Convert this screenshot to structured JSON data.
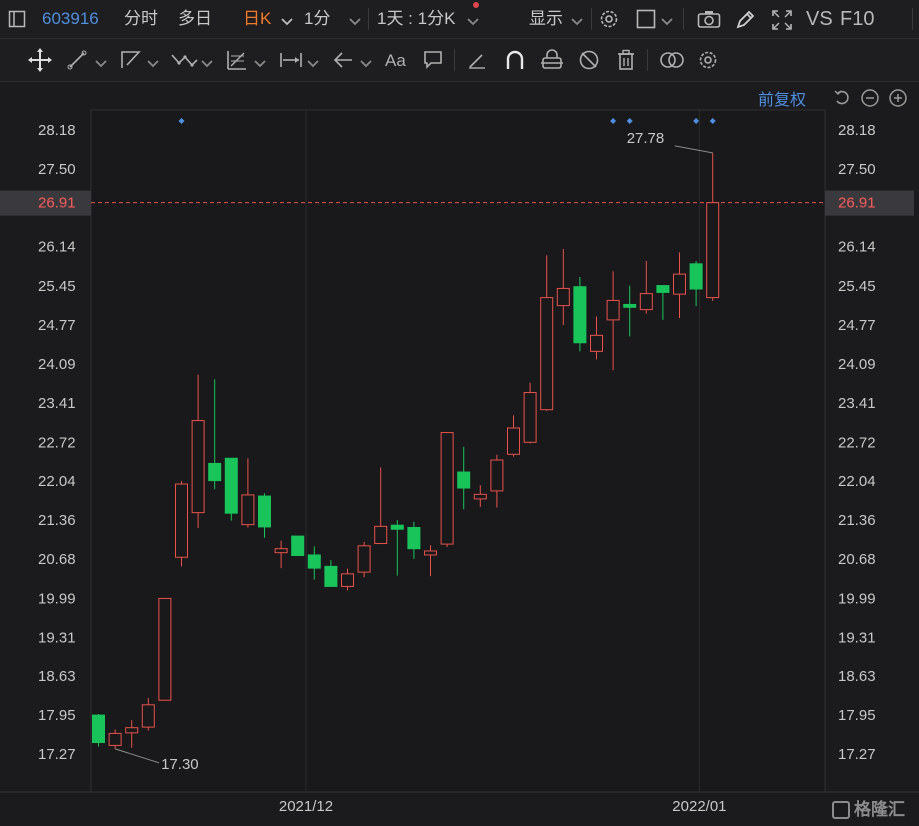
{
  "toolbar": {
    "code": "603916",
    "tab_fenshi": "分时",
    "tab_duori": "多日",
    "tab_rik": "日K",
    "tab_1fen": "1分",
    "tab_1tian": "1天 : 1分K",
    "display": "显示",
    "vs": "VS",
    "f10": "F10"
  },
  "chart_header": {
    "adjust_label": "前复权"
  },
  "watermark": "格隆汇",
  "colors": {
    "up": "#e8524a",
    "down": "#19c45a",
    "accent": "#4f8fe0",
    "active_tab": "#f07a2a"
  },
  "icons": [
    "panel-icon",
    "crosshair-icon",
    "line-tool-icon",
    "polyline-tool-icon",
    "wave-tool-icon",
    "fib-tool-icon",
    "range-tool-icon",
    "arrow-tool-icon",
    "text-tool-icon",
    "note-tool-icon",
    "eraser-icon",
    "magnet-icon",
    "lock-icon",
    "hide-icon",
    "trash-icon",
    "compare-icon",
    "settings-icon",
    "camera-icon",
    "pen-icon",
    "fullscreen-icon",
    "undo-icon",
    "zoom-out-icon",
    "zoom-in-icon"
  ],
  "chart_data": {
    "type": "candlestick",
    "y_ticks": [
      "28.18",
      "27.50",
      "26.91",
      "26.14",
      "25.45",
      "24.77",
      "24.09",
      "23.41",
      "22.72",
      "22.04",
      "21.36",
      "20.68",
      "19.99",
      "19.31",
      "18.63",
      "17.95",
      "17.27"
    ],
    "ylim": [
      17.27,
      28.18
    ],
    "current_price": "26.91",
    "x_labels": [
      {
        "label": "2021/12",
        "index": 12.5
      },
      {
        "label": "2022/01",
        "index": 36.2
      }
    ],
    "annotations": {
      "high": "27.78",
      "low": "17.30"
    },
    "candles": [
      {
        "o": 17.95,
        "h": 17.97,
        "l": 17.4,
        "c": 17.47
      },
      {
        "o": 17.42,
        "h": 17.7,
        "l": 17.36,
        "c": 17.63
      },
      {
        "o": 17.64,
        "h": 17.86,
        "l": 17.38,
        "c": 17.73
      },
      {
        "o": 17.74,
        "h": 18.25,
        "l": 17.68,
        "c": 18.13
      },
      {
        "o": 18.21,
        "h": 19.99,
        "l": 18.21,
        "c": 19.99
      },
      {
        "o": 20.71,
        "h": 22.04,
        "l": 20.55,
        "c": 21.99
      },
      {
        "o": 21.49,
        "h": 23.9,
        "l": 21.22,
        "c": 23.1
      },
      {
        "o": 22.35,
        "h": 23.82,
        "l": 21.9,
        "c": 22.05
      },
      {
        "o": 22.44,
        "h": 22.44,
        "l": 21.35,
        "c": 21.48
      },
      {
        "o": 21.28,
        "h": 22.44,
        "l": 21.23,
        "c": 21.8
      },
      {
        "o": 21.78,
        "h": 21.83,
        "l": 21.05,
        "c": 21.24
      },
      {
        "o": 20.79,
        "h": 21.0,
        "l": 20.52,
        "c": 20.86
      },
      {
        "o": 21.08,
        "h": 21.08,
        "l": 20.8,
        "c": 20.74
      },
      {
        "o": 20.75,
        "h": 20.9,
        "l": 20.32,
        "c": 20.52
      },
      {
        "o": 20.55,
        "h": 20.66,
        "l": 20.2,
        "c": 20.2
      },
      {
        "o": 20.2,
        "h": 20.51,
        "l": 20.13,
        "c": 20.42
      },
      {
        "o": 20.45,
        "h": 20.98,
        "l": 20.36,
        "c": 20.91
      },
      {
        "o": 20.95,
        "h": 22.28,
        "l": 20.99,
        "c": 21.25
      },
      {
        "o": 21.27,
        "h": 21.36,
        "l": 20.39,
        "c": 21.2
      },
      {
        "o": 21.23,
        "h": 21.33,
        "l": 20.68,
        "c": 20.86
      },
      {
        "o": 20.75,
        "h": 20.92,
        "l": 20.38,
        "c": 20.82
      },
      {
        "o": 20.94,
        "h": 22.89,
        "l": 20.89,
        "c": 22.89
      },
      {
        "o": 22.2,
        "h": 22.64,
        "l": 21.55,
        "c": 21.92
      },
      {
        "o": 21.73,
        "h": 21.97,
        "l": 21.59,
        "c": 21.81
      },
      {
        "o": 21.87,
        "h": 22.5,
        "l": 21.58,
        "c": 22.41
      },
      {
        "o": 22.51,
        "h": 23.19,
        "l": 22.47,
        "c": 22.97
      },
      {
        "o": 22.72,
        "h": 23.76,
        "l": 22.7,
        "c": 23.59
      },
      {
        "o": 23.29,
        "h": 25.99,
        "l": 23.27,
        "c": 25.25
      },
      {
        "o": 25.11,
        "h": 26.1,
        "l": 24.77,
        "c": 25.41
      },
      {
        "o": 25.44,
        "h": 25.61,
        "l": 24.31,
        "c": 24.46
      },
      {
        "o": 24.31,
        "h": 24.92,
        "l": 24.17,
        "c": 24.59
      },
      {
        "o": 24.86,
        "h": 25.71,
        "l": 23.98,
        "c": 25.2
      },
      {
        "o": 25.13,
        "h": 25.46,
        "l": 24.57,
        "c": 25.08
      },
      {
        "o": 25.04,
        "h": 25.89,
        "l": 24.97,
        "c": 25.32
      },
      {
        "o": 25.46,
        "h": 25.46,
        "l": 24.86,
        "c": 25.34
      },
      {
        "o": 25.31,
        "h": 26.04,
        "l": 24.89,
        "c": 25.66
      },
      {
        "o": 25.84,
        "h": 25.89,
        "l": 25.1,
        "c": 25.4
      },
      {
        "o": 25.25,
        "h": 27.78,
        "l": 25.19,
        "c": 26.91
      }
    ]
  }
}
